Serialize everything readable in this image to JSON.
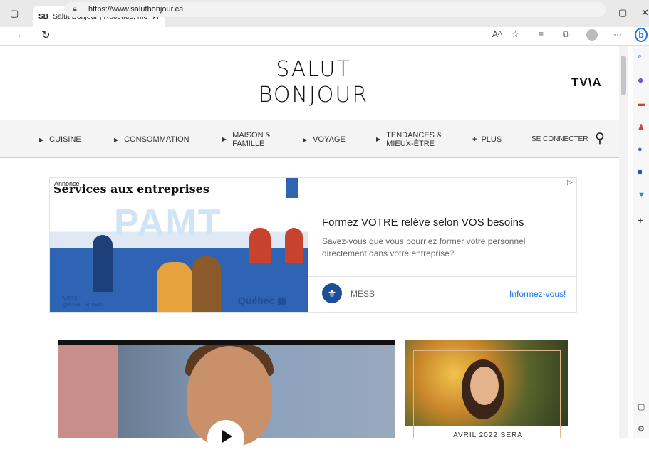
{
  "browser": {
    "tab_title": "Salut Bonjour | Recettes, Mode et",
    "tab_favicon": "SB",
    "url": "https://www.salutbonjour.ca",
    "read_aloud": "Aᴬ"
  },
  "site": {
    "logo_line1": "SALUT",
    "logo_line2": "BONJOUR",
    "partner_logo": "TV\\A",
    "nav": [
      {
        "label": "CUISINE"
      },
      {
        "label": "CONSOMMATION"
      },
      {
        "label": "MAISON &\nFAMILLE"
      },
      {
        "label": "VOYAGE"
      },
      {
        "label": "TENDANCES &\nMIEUX-ÊTRE"
      },
      {
        "label": "PLUS"
      }
    ],
    "login": "SE CONNECTER"
  },
  "ad": {
    "label": "Annonce",
    "image_title": "Services aux entreprises",
    "image_word": "PAMT",
    "headline": "Formez VOTRE relève selon VOS besoins",
    "body": "Savez-vous que vous pourriez former votre personnel directement dans votre entreprise?",
    "advertiser": "MESS",
    "cta": "Informez-vous!",
    "gov_line1": "Votre",
    "gov_line2": "gouvernement",
    "quebec": "Québec"
  },
  "card": {
    "text": "AVRIL 2022 SERA"
  },
  "colors": {
    "accent_blue": "#1a73e8",
    "quebec_blue": "#1f4e99"
  }
}
